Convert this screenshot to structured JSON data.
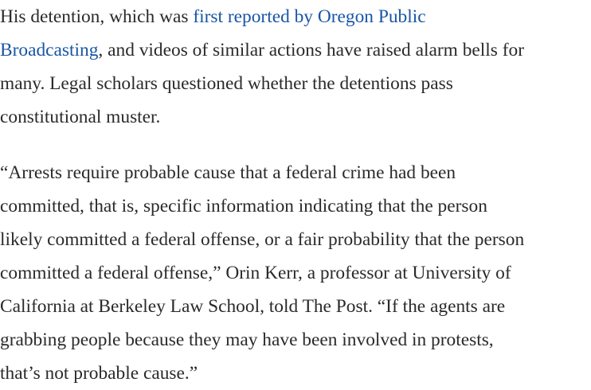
{
  "colors": {
    "text": "#2a2a2a",
    "link": "#1955a5",
    "background": "#ffffff"
  },
  "paragraph_1": {
    "line_1_before": "His detention, which was ",
    "line_1_link": "first reported by Oregon Public",
    "line_2_link": "Broadcasting",
    "line_2_after": ", and videos of similar actions have raised alarm bells for",
    "line_3": "many. Legal scholars questioned whether the detentions pass",
    "line_4": "constitutional muster."
  },
  "paragraph_2": {
    "lines": [
      "“Arrests require probable cause that a federal crime had been",
      "committed, that is, specific information indicating that the person",
      "likely committed a federal offense, or a fair probability that the person",
      "committed a federal offense,” Orin Kerr, a professor at University of",
      "California at Berkeley Law School, told The Post. “If the agents are",
      "grabbing people because they may have been involved in protests,",
      "that’s not probable cause.”"
    ]
  }
}
